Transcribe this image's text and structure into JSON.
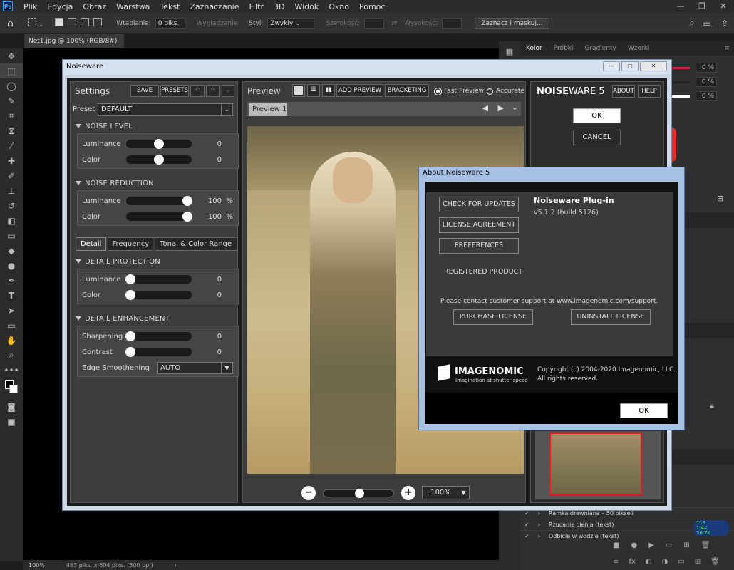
{
  "photoshop": {
    "menu": [
      "Plik",
      "Edycja",
      "Obraz",
      "Warstwa",
      "Tekst",
      "Zaznaczanie",
      "Filtr",
      "3D",
      "Widok",
      "Okno",
      "Pomoc"
    ],
    "options": {
      "feather_label": "Wtapianie:",
      "feather_value": "0 piks.",
      "antialias_label": "Wygładzanie",
      "style_label": "Styl:",
      "style_value": "Zwykły",
      "width_label": "Szerokość:",
      "height_label": "Wysokość:",
      "select_mask_button": "Zaznacz i maskuj..."
    },
    "doc_tab": "Net1.jpg @ 100% (RGB/8#)",
    "status": {
      "zoom": "100%",
      "size": "483 piks. x 604 piks. (300 ppi)"
    },
    "right_panel": {
      "tabs": [
        "Kolor",
        "Próbki",
        "Gradienty",
        "Wzorki"
      ],
      "percents": [
        "0 %",
        "0 %",
        "0 %"
      ],
      "layers": [
        "Ramka drewniana – 50 pikseli",
        "Rzucanie cienia (tekst)",
        "Odbicie w wodzie (tekst)"
      ]
    },
    "net_meter": {
      "a": "119",
      "b": "1.4K",
      "c": "26.7K"
    }
  },
  "noiseware": {
    "title": "Noiseware",
    "settings": {
      "header": "Settings",
      "save": "SAVE",
      "presets": "PRESETS",
      "preset_label": "Preset",
      "preset_value": "DEFAULT",
      "noise_level": {
        "title": "NOISE LEVEL",
        "luminance": "Luminance",
        "luminance_val": "0",
        "color": "Color",
        "color_val": "0"
      },
      "noise_reduction": {
        "title": "NOISE REDUCTION",
        "luminance": "Luminance",
        "luminance_val": "100",
        "color": "Color",
        "color_val": "100",
        "unit": "%"
      },
      "tabs": [
        "Detail",
        "Frequency",
        "Tonal & Color Range"
      ],
      "detail_protection": {
        "title": "DETAIL PROTECTION",
        "luminance": "Luminance",
        "luminance_val": "0",
        "color": "Color",
        "color_val": "0"
      },
      "detail_enhancement": {
        "title": "DETAIL ENHANCEMENT",
        "sharpening": "Sharpening",
        "sharpening_val": "0",
        "contrast": "Contrast",
        "contrast_val": "0",
        "edge": "Edge Smoothening",
        "edge_val": "AUTO"
      }
    },
    "preview": {
      "header": "Preview",
      "add_preview": "ADD PREVIEW",
      "bracketing": "BRACKETING",
      "fast": "Fast Preview",
      "accurate": "Accurate",
      "tab": "Preview 1",
      "zoom": "100%",
      "zoom_level": 0.5
    },
    "brand": {
      "name_a": "NOISE",
      "name_b": "WARE 5",
      "about": "ABOUT",
      "help": "HELP",
      "ok": "OK",
      "cancel": "CANCEL"
    }
  },
  "about": {
    "title": "About Noiseware 5",
    "check_updates": "CHECK FOR UPDATES",
    "license_agreement": "LICENSE AGREEMENT",
    "preferences": "PREFERENCES",
    "product": "Noiseware Plug-in",
    "version": "v5.1.2 (build 5126)",
    "registered": "REGISTERED PRODUCT",
    "support": "Please contact customer support at www.imagenomic.com/support.",
    "purchase": "PURCHASE LICENSE",
    "uninstall": "UNINSTALL LICENSE",
    "logo": "IMAGENOMIC",
    "tagline": "Imagination at shutter speed",
    "copyright": "Copyright (c) 2004-2020 Imagenomic, LLC.",
    "rights": "All rights reserved.",
    "ok": "OK"
  }
}
